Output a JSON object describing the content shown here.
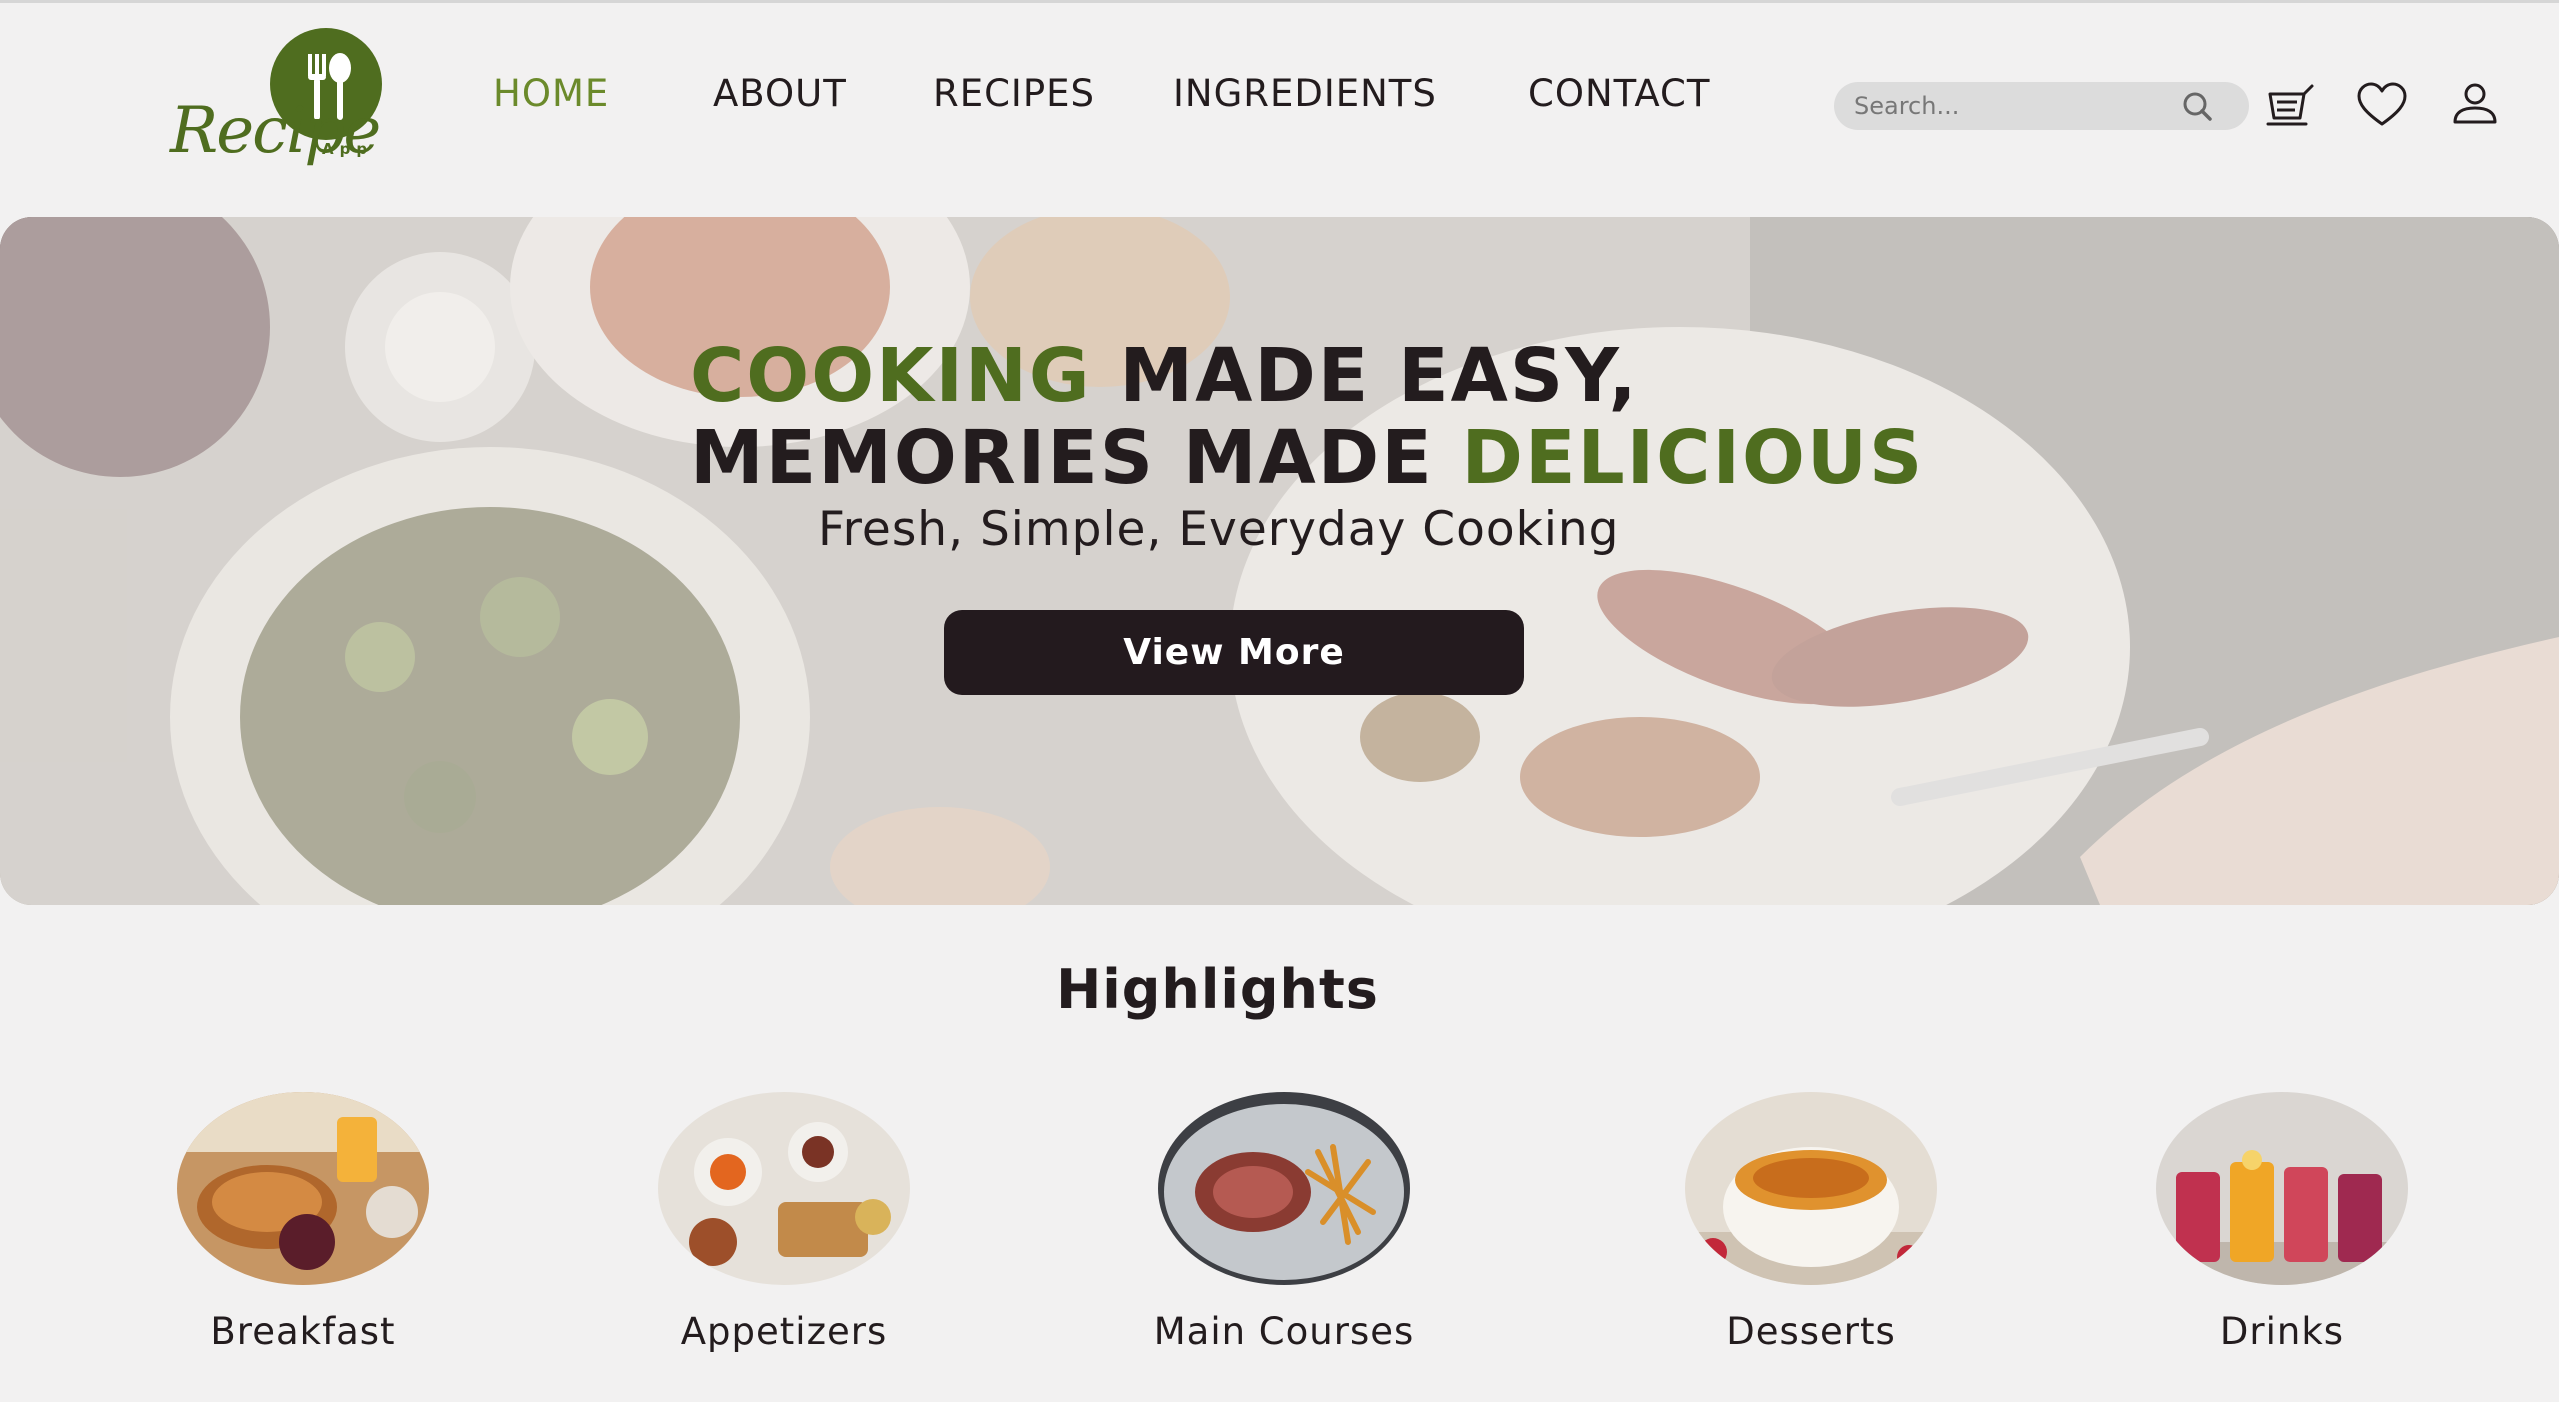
{
  "brand": {
    "logo_text": "Recipe",
    "logo_sub": "App",
    "accent_color": "#4f6d1f",
    "nav_active_color": "#6b8a2b",
    "dark_color": "#231a1e"
  },
  "nav": {
    "items": [
      {
        "label": "HOME",
        "active": true
      },
      {
        "label": "ABOUT",
        "active": false
      },
      {
        "label": "RECIPES",
        "active": false
      },
      {
        "label": "INGREDIENTS",
        "active": false
      },
      {
        "label": "CONTACT",
        "active": false
      }
    ]
  },
  "search": {
    "placeholder": "Search...",
    "icon": "search-icon"
  },
  "header_icons": [
    "shopping-list-icon",
    "heart-icon",
    "user-icon"
  ],
  "hero": {
    "line1_accent": "COOKING",
    "line1_rest": " MADE EASY,",
    "line2_rest": "MEMORIES MADE ",
    "line2_accent": "DELICIOUS",
    "subtitle": "Fresh, Simple, Everyday Cooking",
    "button_label": "View More"
  },
  "highlights": {
    "title": "Highlights",
    "categories": [
      {
        "label": "Breakfast"
      },
      {
        "label": "Appetizers"
      },
      {
        "label": "Main Courses"
      },
      {
        "label": "Desserts"
      },
      {
        "label": "Drinks"
      }
    ]
  }
}
